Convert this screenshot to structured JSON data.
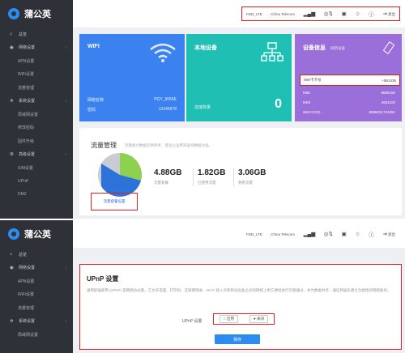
{
  "app": {
    "title": "蒲公英"
  },
  "sidebar": {
    "items": [
      {
        "label": "总览",
        "icon": "home-icon",
        "sub": false,
        "chevron": false
      },
      {
        "label": "网络设置",
        "icon": "globe-icon",
        "sub": false,
        "chevron": true
      },
      {
        "label": "APN设置",
        "sub": true
      },
      {
        "label": "WiFi设置",
        "sub": true
      },
      {
        "label": "流量管理",
        "sub": true
      },
      {
        "label": "系统设置",
        "icon": "gear-icon",
        "sub": false,
        "chevron": true
      },
      {
        "label": "局域网设置",
        "sub": true
      },
      {
        "label": "修改密码",
        "sub": true
      },
      {
        "label": "固件升级",
        "sub": true
      },
      {
        "label": "高级设置",
        "icon": "settings-icon",
        "sub": false,
        "chevron": true
      },
      {
        "label": "SIM设置",
        "sub": true
      },
      {
        "label": "UPnP",
        "sub": true
      },
      {
        "label": "DMZ",
        "sub": true
      }
    ],
    "items2": [
      {
        "label": "总览",
        "icon": "home-icon",
        "sub": false,
        "chevron": false
      },
      {
        "label": "网络设置",
        "icon": "globe-icon",
        "sub": false,
        "chevron": true
      },
      {
        "label": "APN设置",
        "sub": true
      },
      {
        "label": "WiFi设置",
        "sub": true
      },
      {
        "label": "流量管理",
        "sub": true
      },
      {
        "label": "系统设置",
        "icon": "gear-icon",
        "sub": false,
        "chevron": true
      },
      {
        "label": "局域网设置",
        "sub": true
      }
    ]
  },
  "topbar": {
    "network": "FDD_LTE",
    "carrier": "China Telecom",
    "logout": "退出"
  },
  "wifi_card": {
    "title": "WIFI",
    "ssid_label": "网络名称",
    "ssid": "PGY_9055E",
    "password_label": "密码",
    "password": "12345678"
  },
  "local_card": {
    "title": "本地设备",
    "count_label": "连接数量",
    "count": "0"
  },
  "device_card": {
    "title": "设备信息",
    "sub": "刷新设备",
    "sim_label": "SIM卡卡号",
    "sim_value": "+861536",
    "imei_label": "IMEI",
    "imei_value": "8686150",
    "imsi_label": "IMSI",
    "imsi_value": "4601100",
    "iccid_label": "SIM ICCID",
    "iccid_value": "8986031724351"
  },
  "traffic": {
    "title": "流量管理",
    "hint": "流量统计数据仅供参考，建议以运营商查询数据为准。",
    "stats": [
      {
        "value": "4.88GB",
        "desc": "流量套餐"
      },
      {
        "value": "1.82GB",
        "desc": "已使用流量"
      },
      {
        "value": "3.06GB",
        "desc": "剩余流量"
      }
    ],
    "reset_label": "流量套餐设置",
    "pie_colors": [
      "#8ed151",
      "#2d72d9",
      "#c9ccd3"
    ]
  },
  "upnp": {
    "title": "UPnP 设置",
    "desc": "通用即插即用 (UPnP) 是网络协议集，它允许电脑、打印机、互联网网关、Wi-Fi 接入点和移动设备之间的网络上更方便地进行可相通过，并为数据共享、通信和娱乐建立功能性的网络服务。",
    "field_label": "UPnP 设置",
    "enable_label": "启用",
    "disable_label": "关闭",
    "save_label": "保存"
  }
}
